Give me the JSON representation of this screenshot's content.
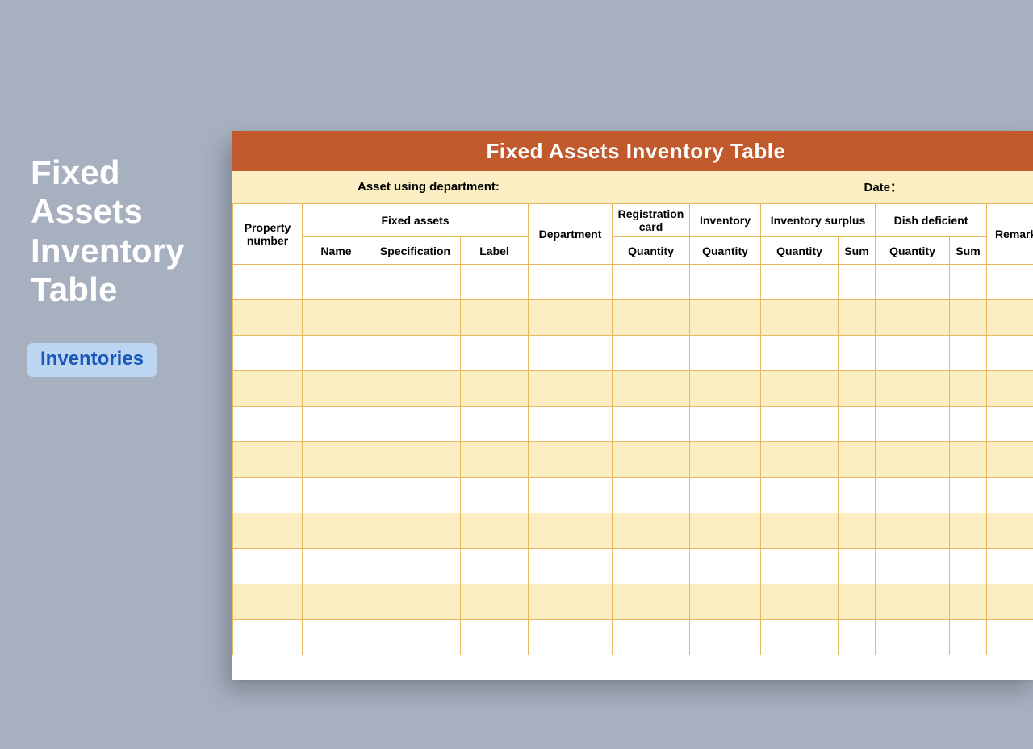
{
  "side": {
    "title_line1": "Fixed",
    "title_line2": "Assets",
    "title_line3": "Inventory",
    "title_line4": "Table",
    "tag_label": "Inventories"
  },
  "sheet": {
    "title": "Fixed Assets Inventory Table",
    "meta_department_label": "Asset using department:",
    "meta_date_label": "Date：",
    "headers": {
      "property_number": "Property number",
      "fixed_assets_group": "Fixed assets",
      "name": "Name",
      "specification": "Specification",
      "label": "Label",
      "department": "Department",
      "registration_card": "Registration card",
      "inventory": "Inventory",
      "inventory_surplus": "Inventory surplus",
      "dish_deficient": "Dish deficient",
      "remarks": "Remarks",
      "quantity": "Quantity",
      "sum": "Sum"
    },
    "rows": [
      {},
      {},
      {},
      {},
      {},
      {},
      {},
      {},
      {},
      {},
      {}
    ]
  }
}
